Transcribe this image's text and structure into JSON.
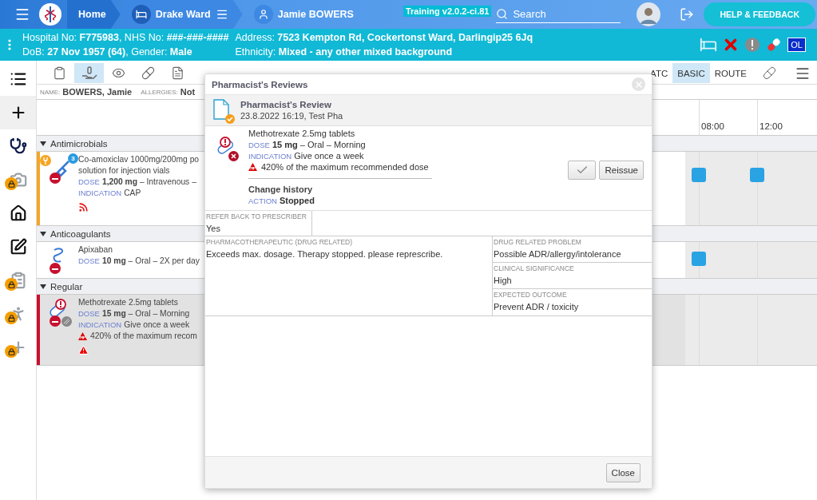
{
  "top_bar": {
    "breadcrumbs": [
      {
        "kind": "home",
        "label": "Home"
      },
      {
        "kind": "ward",
        "label": "Drake Ward"
      },
      {
        "kind": "patient",
        "label": "Jamie BOWERS"
      }
    ],
    "environment": "Training v2.0.2-ci.81",
    "search": {
      "placeholder": "Search"
    },
    "help_button": "HELP & FEEDBACK"
  },
  "patient_bar": {
    "lines_left": [
      "Hospital No: **F775983**, NHS No: **###-###-####**",
      "DoB: **27 Nov 1957 (64)**, Gender: **Male**"
    ],
    "lines_right": [
      "Address: **7523 Kempton Rd, Cockertonst Ward, Darlingip25 6Jq**",
      "Ethnicity: **Mixed - any other mixed background**"
    ],
    "alerts": [
      {
        "kind": "bed"
      },
      {
        "kind": "cross"
      },
      {
        "kind": "warning"
      },
      {
        "kind": "pill"
      },
      {
        "kind": "label",
        "text": "OL"
      }
    ]
  },
  "sidebar": {
    "items": [
      {
        "kind": "list",
        "locked": false
      },
      {
        "kind": "add",
        "locked": false
      },
      {
        "kind": "stethoscope",
        "locked": false
      },
      {
        "kind": "camera",
        "locked": true
      },
      {
        "kind": "home",
        "locked": false
      },
      {
        "kind": "sign",
        "locked": false
      },
      {
        "kind": "clipboard",
        "locked": true
      },
      {
        "kind": "walk",
        "locked": true
      },
      {
        "kind": "add",
        "locked": true
      }
    ]
  },
  "toolbar": {
    "tools": [
      {
        "kind": "chart",
        "selected": false
      },
      {
        "kind": "administer",
        "selected": true
      },
      {
        "kind": "view",
        "selected": false
      },
      {
        "kind": "pill",
        "selected": false
      },
      {
        "kind": "document",
        "selected": false
      }
    ],
    "views": [
      {
        "label": "ATC",
        "selected": false
      },
      {
        "label": "BASIC",
        "selected": true
      },
      {
        "label": "ROUTE",
        "selected": false
      }
    ]
  },
  "patient_strip": {
    "name_label": "NAME:",
    "name": "BOWERS, Jamie",
    "allergies_label": "ALLERGIES:",
    "allergies": "Not"
  },
  "timeline": {
    "times": [
      "08:00",
      "12:00"
    ]
  },
  "groups": [
    {
      "name": "Antimicrobials",
      "expanded": true,
      "meds": [
        {
          "kind": "syringe",
          "color": "#f5a623",
          "selected": false,
          "counter": "3",
          "food_alert": true,
          "name_lines": [
            "Co-amoxiclav 1000mg/200mg po",
            "solution for injection vials"
          ],
          "details": [
            {
              "label": "DOSE",
              "value": "**1,200 mg** – Intravenous –"
            },
            {
              "label": "INDICATION",
              "value": "CAP"
            }
          ],
          "alerts": [
            {
              "kind": "signal"
            }
          ],
          "scheduled": [
            true,
            true
          ]
        }
      ]
    },
    {
      "name": "Anticoagulants",
      "expanded": true,
      "meds": [
        {
          "kind": "syrup",
          "selected": false,
          "name_lines": [
            "Apixaban"
          ],
          "details": [
            {
              "label": "DOSE",
              "value": "**10 mg** – Oral – 2X per day"
            }
          ],
          "scheduled": [
            true,
            false
          ]
        }
      ]
    },
    {
      "name": "Regular",
      "expanded": true,
      "meds": [
        {
          "kind": "pill",
          "color": "#c8102e",
          "selected": true,
          "name_lines": [
            "Methotrexate 2.5mg tablets"
          ],
          "details": [
            {
              "label": "DOSE",
              "value": "**15 mg** – Oral – Morning"
            },
            {
              "label": "INDICATION",
              "value": "Give once a week"
            }
          ],
          "warning": "420% of the maximum recom",
          "alerts": [
            {
              "kind": "warning"
            }
          ],
          "scheduled": [
            false,
            false
          ]
        }
      ]
    }
  ],
  "modal": {
    "title": "Pharmacist's Reviews",
    "review": {
      "title": "Pharmacist's Review",
      "meta": "23.8.2022 16:19, Test Pha",
      "completed": true
    },
    "medication": {
      "name": "Methotrexate 2.5mg tablets",
      "stopped": true,
      "details": [
        {
          "label": "DOSE",
          "value": "**15 mg** – Oral – Morning"
        },
        {
          "label": "INDICATION",
          "value": "Give once a week"
        }
      ],
      "warning": "420% of the maximum recommended dose",
      "history_title": "Change history",
      "history": [
        {
          "label": "ACTION",
          "value": "Stopped"
        }
      ]
    },
    "actions": [
      {
        "kind": "approve"
      },
      {
        "kind": "text",
        "label": "Reissue"
      }
    ],
    "fields_top": [
      {
        "label": "REFER BACK TO PRESCRIBER",
        "value": "Yes"
      }
    ],
    "fields_left": [
      {
        "label": "PHARMACOTHERAPEUTIC (DRUG RELATED)",
        "value": "Exceeds max. dosage. Therapy stopped. please represcribe."
      }
    ],
    "fields_right": [
      {
        "label": "DRUG RELATED PROBLEM",
        "value": "Possible ADR/allergy/intolerance"
      },
      {
        "label": "CLINICAL SIGNIFICANCE",
        "value": "High"
      },
      {
        "label": "EXPECTED OUTCOME",
        "value": "Prevent ADR / toxicity"
      }
    ],
    "close_button": "Close"
  }
}
